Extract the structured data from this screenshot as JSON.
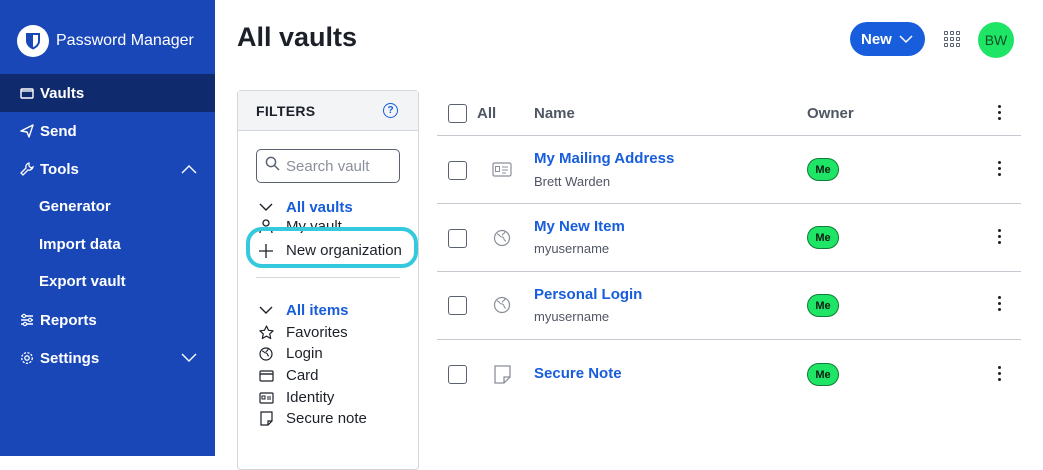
{
  "app": {
    "name": "Password Manager"
  },
  "sidebar": {
    "items": [
      {
        "label": "Vaults",
        "icon": "vault-icon",
        "active": true
      },
      {
        "label": "Send",
        "icon": "send-icon"
      },
      {
        "label": "Tools",
        "icon": "wrench-icon",
        "expanded": true
      },
      {
        "label": "Generator"
      },
      {
        "label": "Import data"
      },
      {
        "label": "Export vault"
      },
      {
        "label": "Reports",
        "icon": "sliders-icon"
      },
      {
        "label": "Settings",
        "icon": "gear-icon",
        "expanded": false
      }
    ]
  },
  "header": {
    "title": "All vaults",
    "new_label": "New",
    "avatar_initials": "BW"
  },
  "filters": {
    "title": "FILTERS",
    "search_placeholder": "Search vault",
    "vaults": {
      "label": "All vaults",
      "items": [
        "My vault",
        "New organization"
      ]
    },
    "items": {
      "label": "All items",
      "types": [
        "Favorites",
        "Login",
        "Card",
        "Identity",
        "Secure note"
      ]
    }
  },
  "table": {
    "headers": {
      "all": "All",
      "name": "Name",
      "owner": "Owner"
    },
    "rows": [
      {
        "name": "My Mailing Address",
        "sub": "Brett Warden",
        "type": "identity",
        "owner": "Me"
      },
      {
        "name": "My New Item",
        "sub": "myusername",
        "type": "login",
        "owner": "Me"
      },
      {
        "name": "Personal Login",
        "sub": "myusername",
        "type": "login",
        "owner": "Me"
      },
      {
        "name": "Secure Note",
        "sub": "",
        "type": "note",
        "owner": "Me"
      }
    ]
  },
  "colors": {
    "sidebar": "#1a47b8",
    "accent": "#175ddc",
    "badge": "#1ee565",
    "highlight": "#34c9dc"
  }
}
